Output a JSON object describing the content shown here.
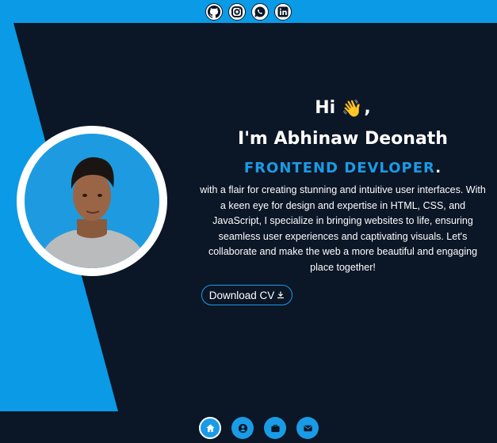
{
  "social": [
    {
      "icon": "github-icon"
    },
    {
      "icon": "instagram-icon"
    },
    {
      "icon": "whatsapp-icon"
    },
    {
      "icon": "linkedin-icon"
    }
  ],
  "hero": {
    "greeting": "Hi",
    "wave_emoji": "👋",
    "greeting_comma": ",",
    "name": "I'm Abhinaw Deonath",
    "role": "FRONTEND DEVLOPER",
    "role_dot": ".",
    "bio": "with a flair for creating stunning and intuitive user interfaces. With a keen eye for design and expertise in HTML, CSS, and JavaScript, I specialize in bringing websites to life, ensuring seamless user experiences and captivating visuals. Let's collaborate and make the web a more beautiful and engaging place together!",
    "cv_label": "Download CV"
  },
  "nav": [
    {
      "icon": "home-icon",
      "active": true
    },
    {
      "icon": "user-icon",
      "active": false
    },
    {
      "icon": "briefcase-icon",
      "active": false
    },
    {
      "icon": "mail-icon",
      "active": false
    }
  ],
  "colors": {
    "accent": "#1a9be6",
    "background": "#0b1626",
    "topbar": "#0a9ae6"
  }
}
